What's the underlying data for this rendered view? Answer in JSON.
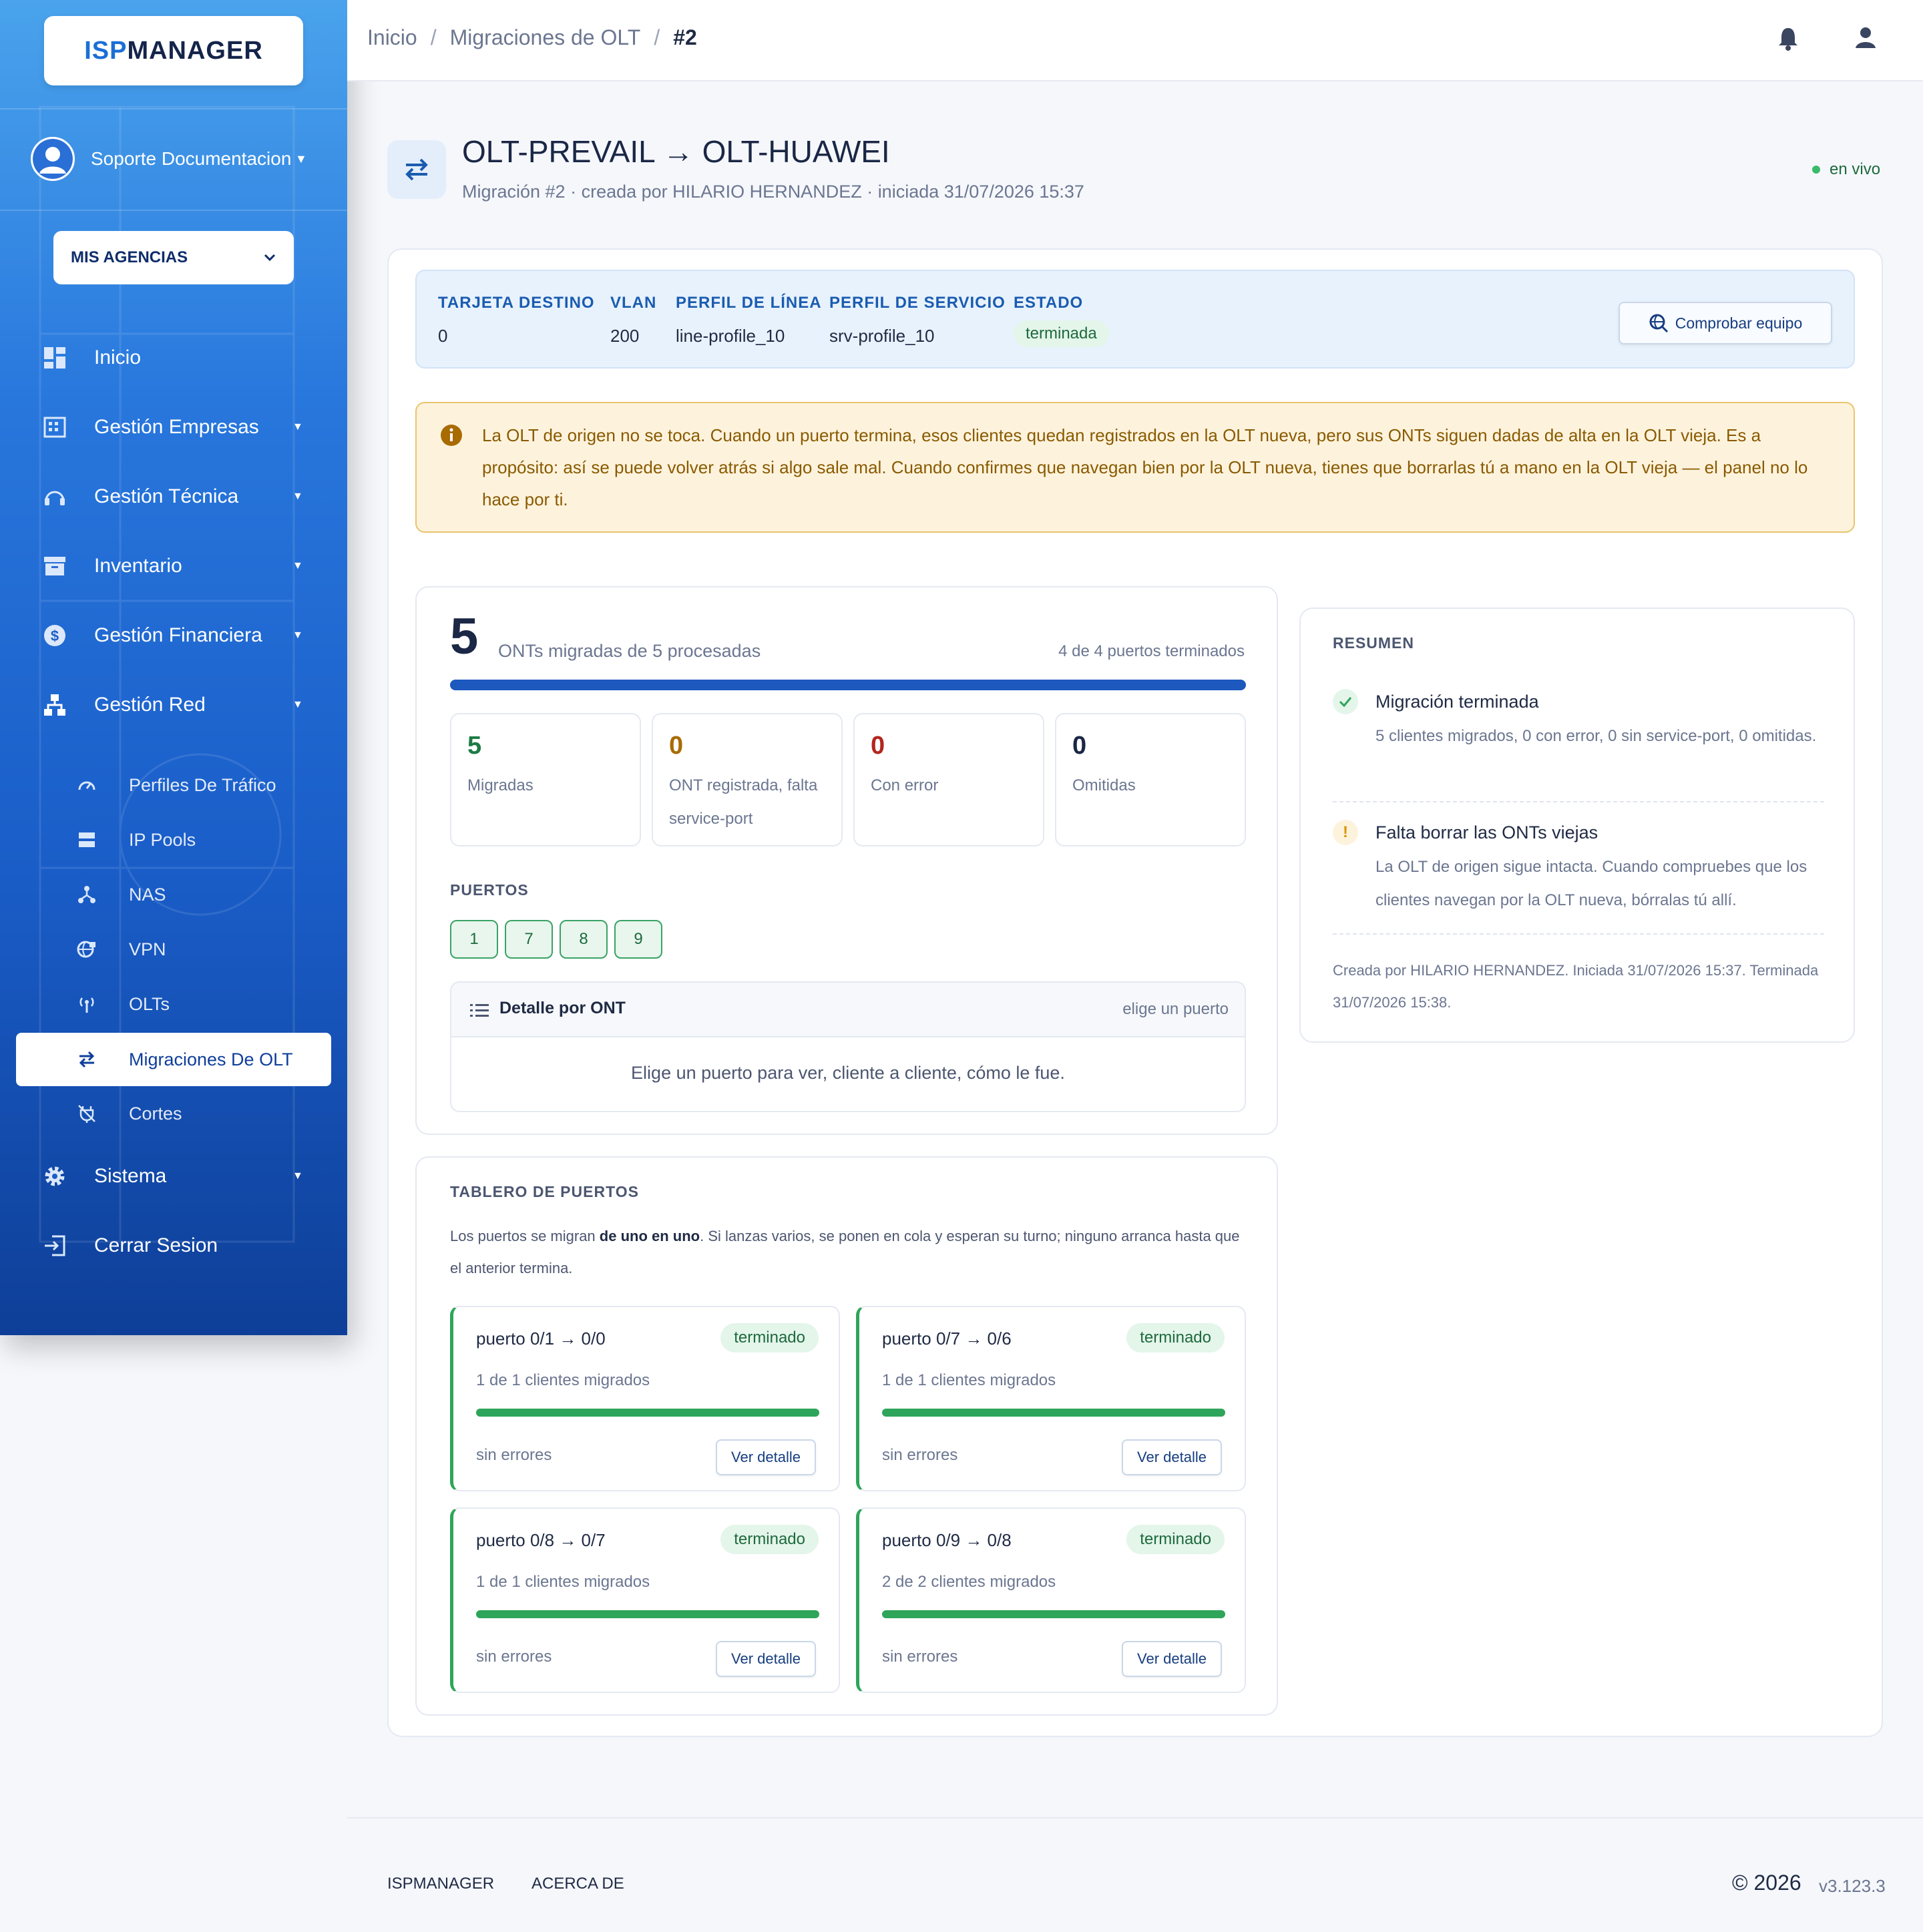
{
  "app": {
    "logo_isp": "ISP",
    "logo_manager": "MANAGER"
  },
  "sidebar": {
    "user": "Soporte Documentacion",
    "agency": "MIS AGENCIAS",
    "items": [
      {
        "label": "Inicio",
        "icon": "dashboard-icon"
      },
      {
        "label": "Gestión Empresas",
        "icon": "building-icon"
      },
      {
        "label": "Gestión Técnica",
        "icon": "headset-icon"
      },
      {
        "label": "Inventario",
        "icon": "archive-icon"
      },
      {
        "label": "Gestión Financiera",
        "icon": "dollar-icon"
      },
      {
        "label": "Gestión Red",
        "icon": "network-icon"
      },
      {
        "label": "Sistema",
        "icon": "gear-icon"
      },
      {
        "label": "Cerrar Sesion",
        "icon": "logout-icon"
      }
    ],
    "sub_items": [
      {
        "label": "Perfiles De Tráfico"
      },
      {
        "label": "IP Pools"
      },
      {
        "label": "NAS"
      },
      {
        "label": "VPN"
      },
      {
        "label": "OLTs"
      },
      {
        "label": "Migraciones De OLT"
      },
      {
        "label": "Cortes"
      }
    ]
  },
  "topbar": {
    "crumbs": [
      "Inicio",
      "Migraciones de OLT",
      "#2"
    ],
    "sep": "/"
  },
  "header": {
    "title": "OLT-PREVAIL → OLT-HUAWEI",
    "subtitle": "Migración #2 · creada por HILARIO HERNANDEZ · iniciada 31/07/2026 15:37",
    "live": "en vivo"
  },
  "info": {
    "columns": [
      {
        "h": "TARJETA DESTINO",
        "v": "0"
      },
      {
        "h": "VLAN",
        "v": "200"
      },
      {
        "h": "PERFIL DE LÍNEA",
        "v": "line-profile_10"
      },
      {
        "h": "PERFIL DE SERVICIO",
        "v": "srv-profile_10"
      },
      {
        "h": "ESTADO",
        "v": "terminada"
      }
    ],
    "check_button": "Comprobar equipo"
  },
  "warning": "La OLT de origen no se toca. Cuando un puerto termina, esos clientes quedan registrados en la OLT nueva, pero sus ONTs siguen dadas de alta en la OLT vieja. Es a propósito: así se puede volver atrás si algo sale mal. Cuando confirmes que navegan bien por la OLT nueva, tienes que borrarlas tú a mano en la OLT vieja — el panel no lo hace por ti.",
  "progress": {
    "big": "5",
    "label": "ONTs migradas de 5 procesadas",
    "ports_done": "4 de 4 puertos terminados",
    "fraction": 1.0,
    "stats": [
      {
        "n": "5",
        "l": "Migradas",
        "color": "#1d7a44"
      },
      {
        "n": "0",
        "l": "ONT registrada, falta service-port",
        "color": "#a86b00"
      },
      {
        "n": "0",
        "l": "Con error",
        "color": "#b3261e"
      },
      {
        "n": "0",
        "l": "Omitidas",
        "color": "#1a2745"
      }
    ],
    "puertos_h": "PUERTOS",
    "port_chips": [
      "1",
      "7",
      "8",
      "9"
    ],
    "detail_title": "Detalle por ONT",
    "detail_right": "elige un puerto",
    "detail_body": "Elige un puerto para ver, cliente a cliente, cómo le fue."
  },
  "resumen": {
    "h": "RESUMEN",
    "items": [
      {
        "t": "Migración terminada",
        "d": "5 clientes migrados, 0 con error, 0 sin service-port, 0 omitidas."
      },
      {
        "t": "Falta borrar las ONTs viejas",
        "d": "La OLT de origen sigue intacta. Cuando compruebes que los clientes navegan por la OLT nueva, bórralas tú allí."
      }
    ],
    "footer": "Creada por HILARIO HERNANDEZ. Iniciada 31/07/2026 15:37. Terminada 31/07/2026 15:38."
  },
  "tablero": {
    "h": "TABLERO DE PUERTOS",
    "d_pre": "Los puertos se migran ",
    "d_bold": "de uno en uno",
    "d_post": ". Si lanzas varios, se ponen en cola y esperan su turno; ninguno arranca hasta que el anterior termina.",
    "ports": [
      {
        "t": "puerto 0/1 → 0/0",
        "badge": "terminado",
        "count": "1 de 1 clientes migrados",
        "errors": "sin errores",
        "btn": "Ver detalle",
        "progress": 1.0
      },
      {
        "t": "puerto 0/7 → 0/6",
        "badge": "terminado",
        "count": "1 de 1 clientes migrados",
        "errors": "sin errores",
        "btn": "Ver detalle",
        "progress": 1.0
      },
      {
        "t": "puerto 0/8 → 0/7",
        "badge": "terminado",
        "count": "1 de 1 clientes migrados",
        "errors": "sin errores",
        "btn": "Ver detalle",
        "progress": 1.0
      },
      {
        "t": "puerto 0/9 → 0/8",
        "badge": "terminado",
        "count": "2 de 2 clientes migrados",
        "errors": "sin errores",
        "btn": "Ver detalle",
        "progress": 1.0
      }
    ]
  },
  "footer": {
    "left1": "ISPMANAGER",
    "left2": "ACERCA DE",
    "copy": "© 2026",
    "version": "v3.123.3"
  }
}
